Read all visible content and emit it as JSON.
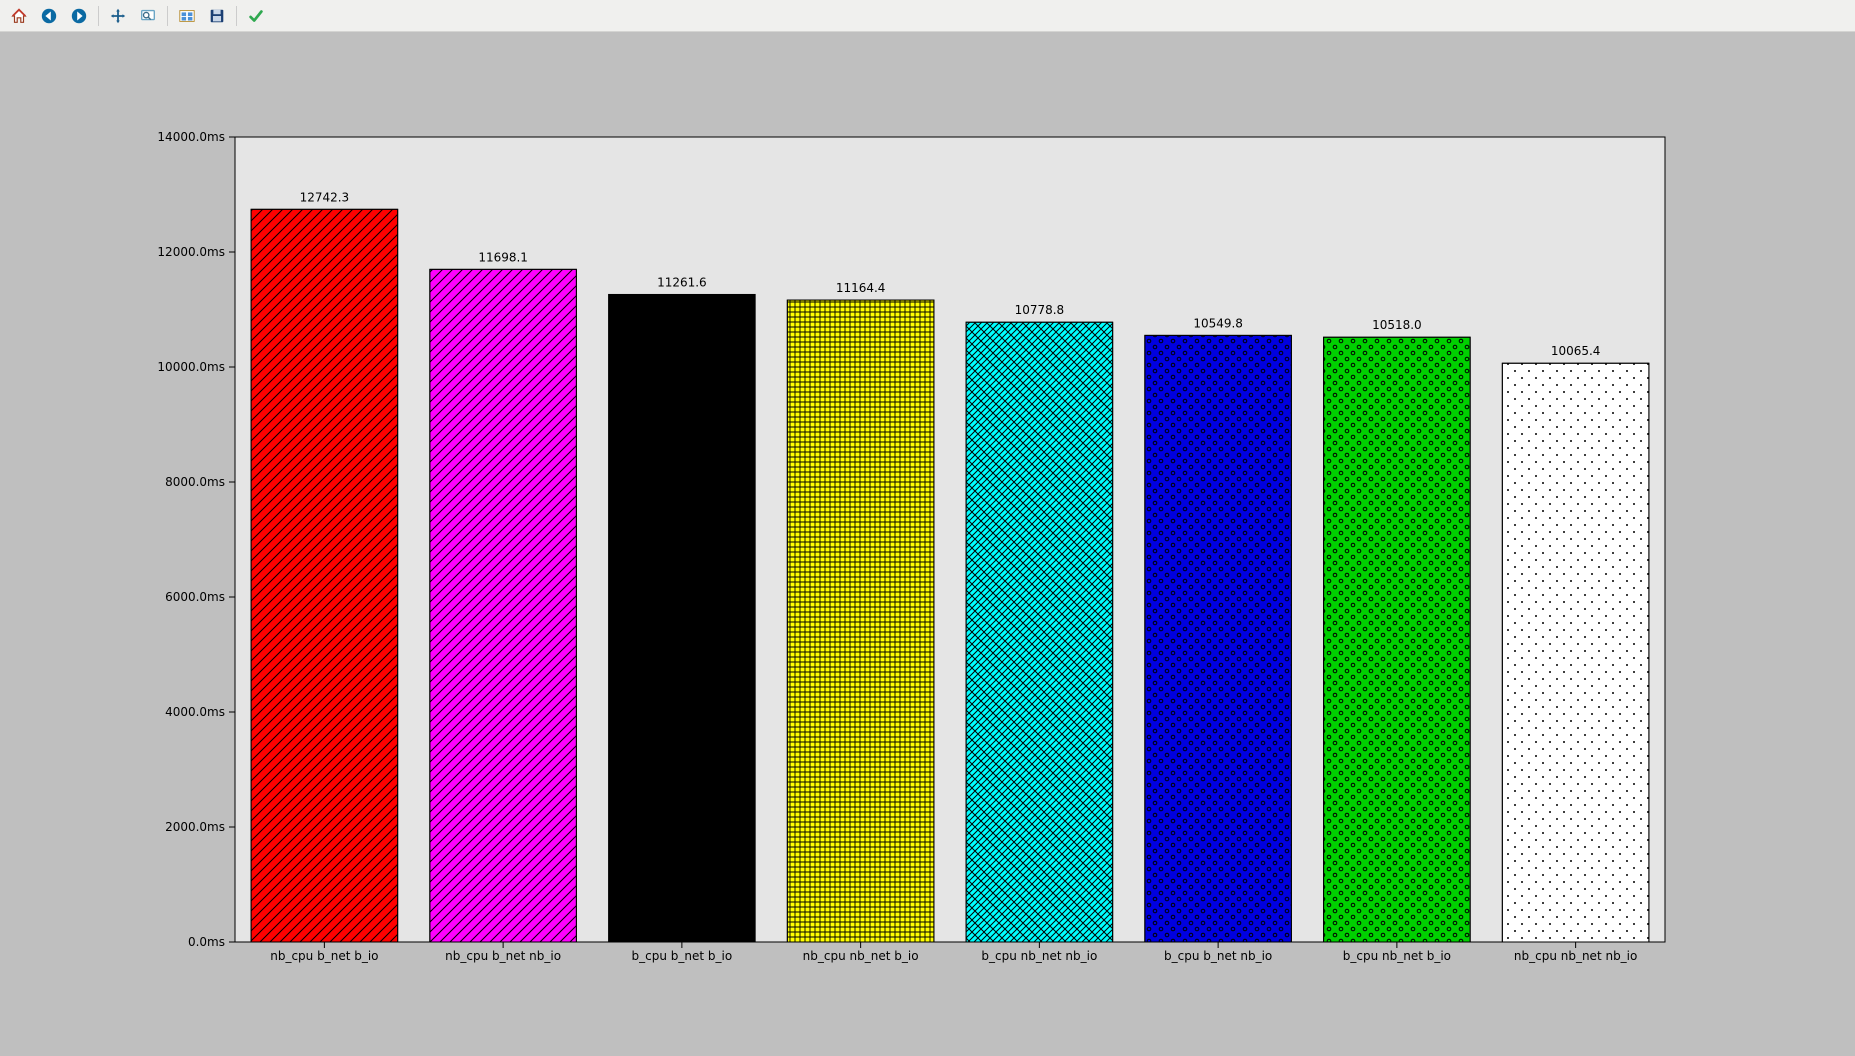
{
  "toolbar": {
    "icons": [
      {
        "name": "home-icon"
      },
      {
        "name": "back-icon"
      },
      {
        "name": "forward-icon"
      },
      {
        "sep": true
      },
      {
        "name": "pan-icon"
      },
      {
        "name": "zoom-icon"
      },
      {
        "sep": true
      },
      {
        "name": "subplots-icon"
      },
      {
        "name": "save-icon"
      },
      {
        "sep": true
      },
      {
        "name": "check-icon"
      }
    ]
  },
  "chart_data": {
    "type": "bar",
    "categories": [
      "nb_cpu b_net b_io",
      "nb_cpu b_net nb_io",
      "b_cpu b_net b_io",
      "nb_cpu nb_net b_io",
      "b_cpu nb_net nb_io",
      "b_cpu b_net nb_io",
      "b_cpu nb_net b_io",
      "nb_cpu nb_net nb_io"
    ],
    "values": [
      12742.3,
      11698.1,
      11261.6,
      11164.4,
      10778.8,
      10549.8,
      10518.0,
      10065.4
    ],
    "value_labels": [
      "12742.3",
      "11698.1",
      "11261.6",
      "11164.4",
      "10778.8",
      "10549.8",
      "10518.0",
      "10065.4"
    ],
    "ylim": [
      0,
      14000
    ],
    "yticks": [
      0,
      2000,
      4000,
      6000,
      8000,
      10000,
      12000,
      14000
    ],
    "ytick_labels": [
      "0.0ms",
      "2000.0ms",
      "4000.0ms",
      "6000.0ms",
      "8000.0ms",
      "10000.0ms",
      "12000.0ms",
      "14000.0ms"
    ],
    "bar_colors": [
      "#ff0000",
      "#ff00ff",
      "#000000",
      "#ffff00",
      "#00ffff",
      "#0000e0",
      "#00d000",
      "#ffffff"
    ],
    "bar_hatches": [
      "diag",
      "diag",
      "solid",
      "grid",
      "cross",
      "dots-big",
      "dots-big",
      "dots-small"
    ],
    "title": "",
    "xlabel": "",
    "ylabel": ""
  }
}
